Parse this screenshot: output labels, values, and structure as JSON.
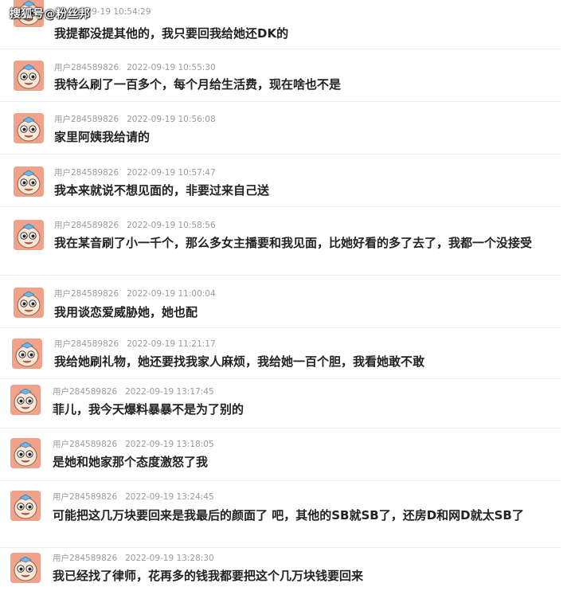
{
  "watermark": "搜狐号@粉丝邦",
  "comments": [
    {
      "user": "",
      "time": "2022-09-19 10:54:29",
      "text": "我提都没提其他的，我只要回我给她还DK的"
    },
    {
      "user": "用户284589826",
      "time": "2022-09-19 10:55:30",
      "text": "我特么刷了一百多个，每个月给生活费，现在啥也不是"
    },
    {
      "user": "用户284589826",
      "time": "2022-09-19 10:56:08",
      "text": "家里阿姨我给请的"
    },
    {
      "user": "用户284589826",
      "time": "2022-09-19 10:57:47",
      "text": "我本来就说不想见面的，非要过来自己送"
    },
    {
      "user": "用户284589826",
      "time": "2022-09-19 10:58:56",
      "text": "我在某音刷了小一千个，那么多女主播要和我见面，比她好看的多了去了，我都一个没接受"
    },
    {
      "user": "用户284589826",
      "time": "2022-09-19 11:00:04",
      "text": "我用谈恋爱威胁她，她也配"
    },
    {
      "user": "用户284589826",
      "time": "2022-09-19 11:21:17",
      "text": "我给她刷礼物，她还要找我家人麻烦，我给她一百个胆，我看她敢不敢"
    },
    {
      "user": "用户284589826",
      "time": "2022-09-19 13:17:45",
      "text": "菲儿，我今天爆料暴暴不是为了别的"
    },
    {
      "user": "用户284589826",
      "time": "2022-09-19 13:18:05",
      "text": "是她和她家那个态度激怒了我"
    },
    {
      "user": "用户284589826",
      "time": "2022-09-19 13:24:45",
      "text": "可能把这几万块要回来是我最后的颜面了 吧，其他的SB就SB了，还房D和网D就太SB了"
    },
    {
      "user": "用户284589826",
      "time": "2022-09-19 13:28:30",
      "text": "我已经找了律师，花再多的钱我都要把这个几万块钱要回来"
    }
  ]
}
